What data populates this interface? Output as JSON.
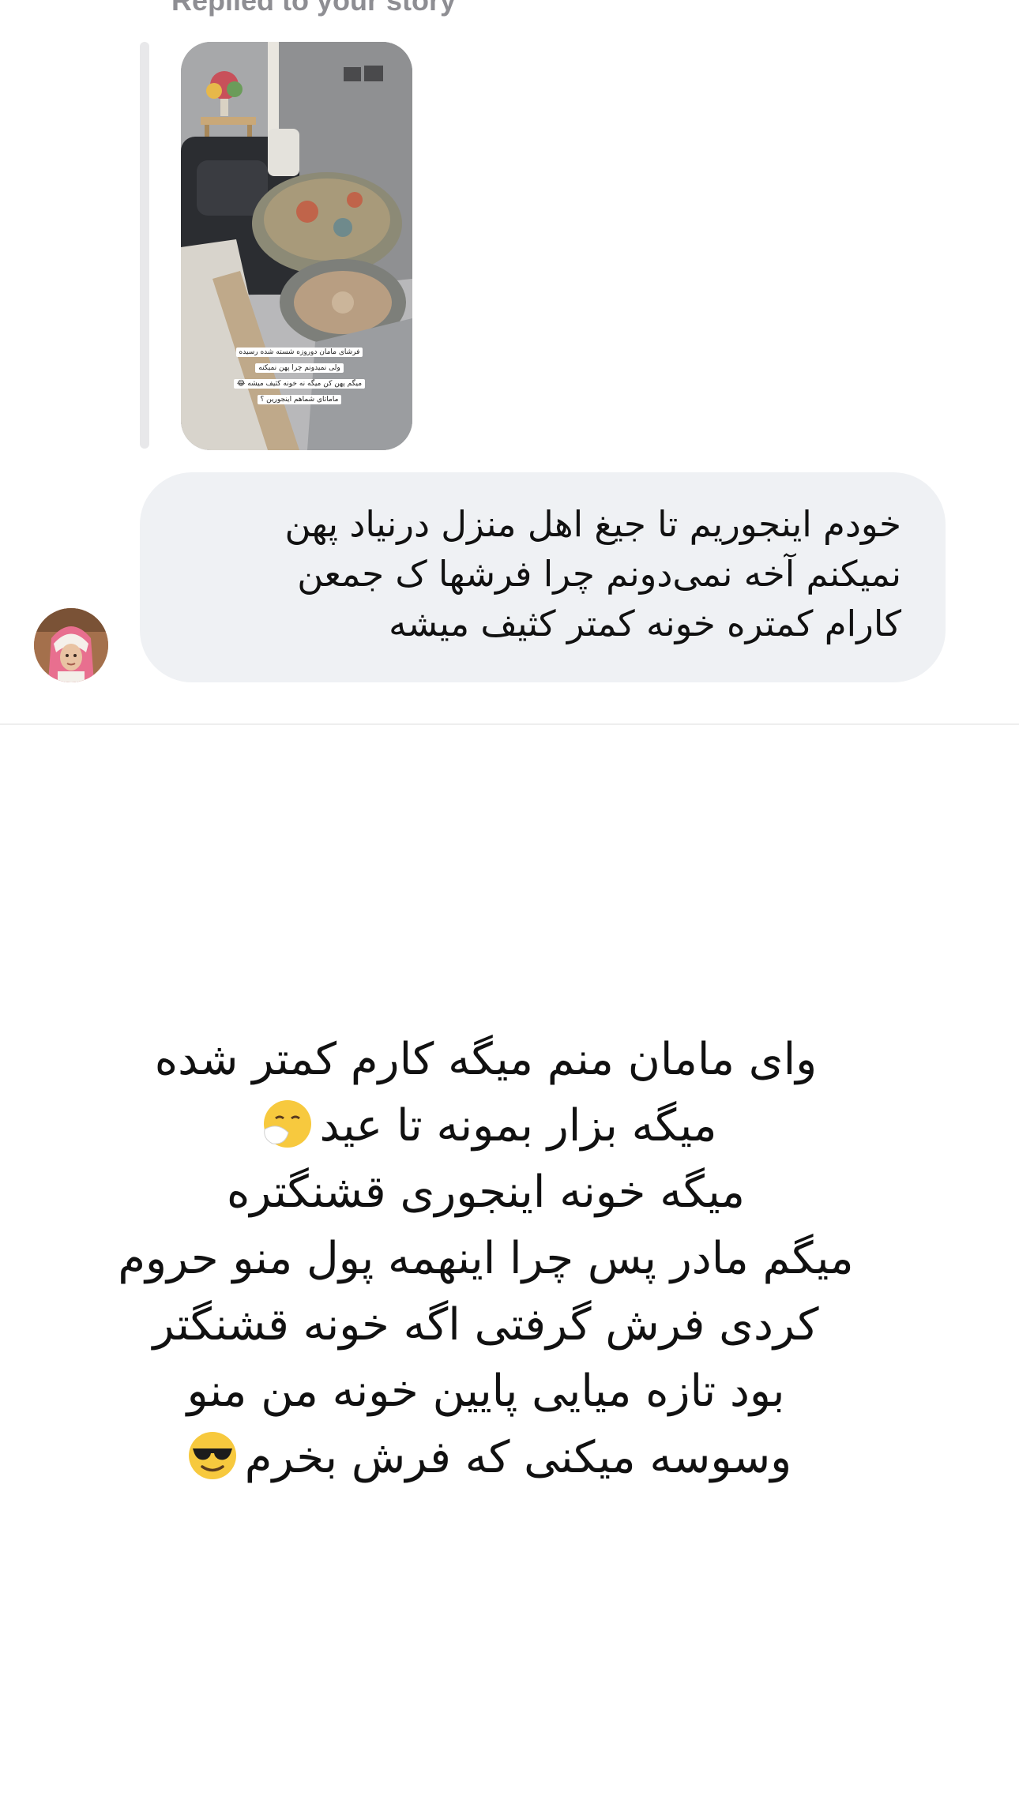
{
  "reply": {
    "label": "Replied to your story",
    "story_caption": [
      "فرشای مامان دوروزه شسته شده رسیده",
      "ولی نمیدونم چرا پهن نمیکنه",
      "میگم پهن کن میگه نه خونه کثیف میشه 😂",
      "ماماتای شماهم اینجورین ؟"
    ]
  },
  "message": {
    "text": "خودم اینجوریم تا جیغ اهل منزل درنیاد پهن\nنمیکنم آخه نمی‌دونم چرا فرشها ک جمعن\nکارام کمتره خونه کمتر کثیف میشه"
  },
  "post": {
    "lines": [
      "وای مامان منم میگه کارم کمتر شده",
      "میگه بزار بمونه تا عید",
      "میگه خونه اینجوری قشنگتره",
      "میگم مادر پس چرا اینهمه پول منو حروم",
      "کردی فرش گرفتی اگه خونه قشنگتر",
      "بود تازه میایی پایین خونه من منو",
      "وسوسه میکنی که فرش بخرم"
    ],
    "line2_emoji": "sneezing-face",
    "line7_emoji": "sunglasses-face"
  },
  "colors": {
    "bubble": "#eff1f4",
    "label": "#8e8e93",
    "text": "#111111"
  }
}
